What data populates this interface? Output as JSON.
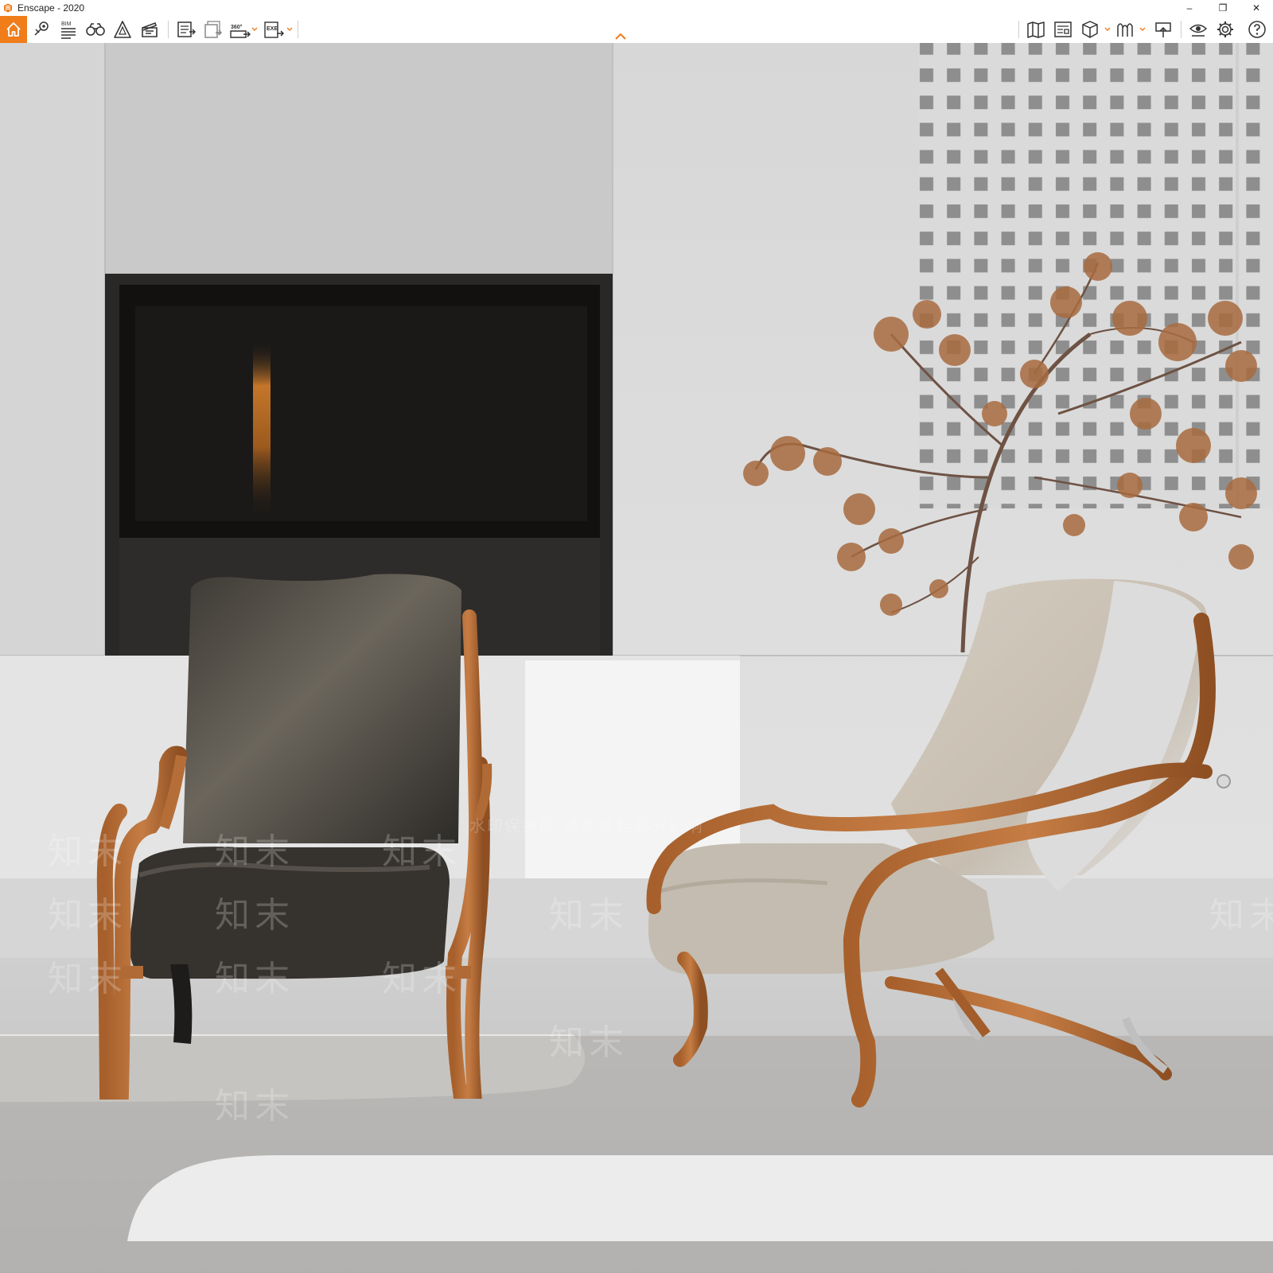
{
  "window": {
    "title": "Enscape - 2020"
  },
  "window_controls": {
    "minimize": "–",
    "restore": "❐",
    "close": "✕"
  },
  "toolbar": {
    "left_buttons": [
      {
        "icon": "home-icon"
      },
      {
        "icon": "views-icon"
      },
      {
        "icon": "bim-icon",
        "label": "BIM"
      },
      {
        "icon": "binoculars-icon"
      },
      {
        "icon": "asset-library-icon"
      },
      {
        "icon": "video-editor-icon"
      },
      {
        "icon": "screenshot-export-icon"
      },
      {
        "icon": "batch-render-icon"
      },
      {
        "icon": "panorama-export-icon",
        "label": "360°"
      },
      {
        "icon": "standalone-export-icon",
        "label": "EXE"
      }
    ],
    "right_buttons": [
      {
        "icon": "map-icon"
      },
      {
        "icon": "info-panel-icon"
      },
      {
        "icon": "material-editor-icon"
      },
      {
        "icon": "asset-library-right-icon"
      },
      {
        "icon": "upload-icon"
      },
      {
        "icon": "visual-settings-icon"
      },
      {
        "icon": "settings-icon"
      },
      {
        "icon": "help-icon"
      }
    ],
    "accent_color": "#f07c1a"
  },
  "viewport": {
    "scene": "interior render: wall with fireplace, two armchairs, maple tree, lattice screen, rug",
    "watermark_text": "知末",
    "watermark_notice": "水印保护区 请勿遮挡部分影响"
  }
}
